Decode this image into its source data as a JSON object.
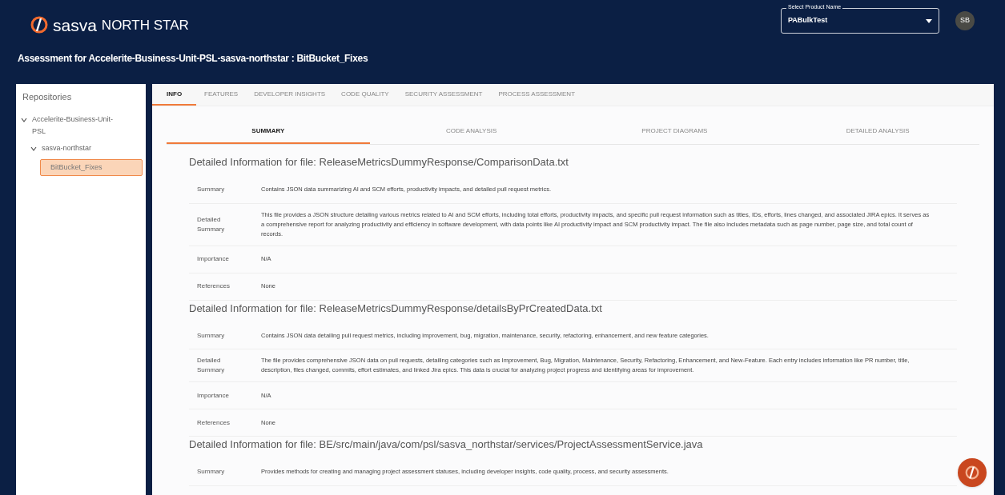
{
  "header": {
    "brand": "sasva",
    "product": "NORTH STAR",
    "product_select": {
      "label": "Select Product Name",
      "value": "PABulkTest"
    },
    "avatar": "SB",
    "assessment_title": "Assessment for Accelerite-Business-Unit-PSL-sasva-northstar : BitBucket_Fixes"
  },
  "sidebar": {
    "title": "Repositories",
    "tree": [
      {
        "label": "Accelerite-Business-Unit-PSL",
        "expanded": true,
        "selected": false,
        "children": [
          {
            "label": "sasva-northstar",
            "expanded": true,
            "selected": false,
            "children": [
              {
                "label": "BitBucket_Fixes",
                "selected": true
              }
            ]
          }
        ]
      }
    ]
  },
  "tabs": [
    {
      "label": "INFO",
      "selected": true
    },
    {
      "label": "FEATURES",
      "selected": false
    },
    {
      "label": "DEVELOPER INSIGHTS",
      "selected": false
    },
    {
      "label": "CODE QUALITY",
      "selected": false
    },
    {
      "label": "SECURITY ASSESSMENT",
      "selected": false
    },
    {
      "label": "PROCESS ASSESSMENT",
      "selected": false
    }
  ],
  "sub_tabs": [
    {
      "label": "SUMMARY",
      "selected": true
    },
    {
      "label": "CODE ANALYSIS",
      "selected": false
    },
    {
      "label": "PROJECT DIAGRAMS",
      "selected": false
    },
    {
      "label": "DETAILED ANALYSIS",
      "selected": false
    }
  ],
  "files": [
    {
      "heading": "Detailed Information for file: ReleaseMetricsDummyResponse/ComparisonData.txt",
      "rows": [
        {
          "label": "Summary",
          "value": "Contains JSON data summarizing AI and SCM efforts, productivity impacts, and detailed pull request metrics."
        },
        {
          "label": "Detailed Summary",
          "value": "This file provides a JSON structure detailing various metrics related to AI and SCM efforts, including total efforts, productivity impacts, and specific pull request information such as titles, IDs, efforts, lines changed, and associated JIRA epics. It serves as a comprehensive report for analyzing productivity and efficiency in software development, with data points like AI productivity impact and SCM productivity impact. The file also includes metadata such as page number, page size, and total count of records."
        },
        {
          "label": "Importance",
          "value": "N/A"
        },
        {
          "label": "References",
          "value": "None"
        }
      ]
    },
    {
      "heading": "Detailed Information for file: ReleaseMetricsDummyResponse/detailsByPrCreatedData.txt",
      "rows": [
        {
          "label": "Summary",
          "value": "Contains JSON data detailing pull request metrics, including improvement, bug, migration, maintenance, security, refactoring, enhancement, and new feature categories."
        },
        {
          "label": "Detailed Summary",
          "value": "The file provides comprehensive JSON data on pull requests, detailing categories such as Improvement, Bug, Migration, Maintenance, Security, Refactoring, Enhancement, and New-Feature. Each entry includes information like PR number, title, description, files changed, commits, effort estimates, and linked Jira epics. This data is crucial for analyzing project progress and identifying areas for improvement."
        },
        {
          "label": "Importance",
          "value": "N/A"
        },
        {
          "label": "References",
          "value": "None"
        }
      ]
    },
    {
      "heading": "Detailed Information for file: BE/src/main/java/com/psl/sasva_northstar/services/ProjectAssessmentService.java",
      "rows": [
        {
          "label": "Summary",
          "value": "Provides methods for creating and managing project assessment statuses, including developer insights, code quality, process, and security assessments."
        }
      ]
    }
  ]
}
